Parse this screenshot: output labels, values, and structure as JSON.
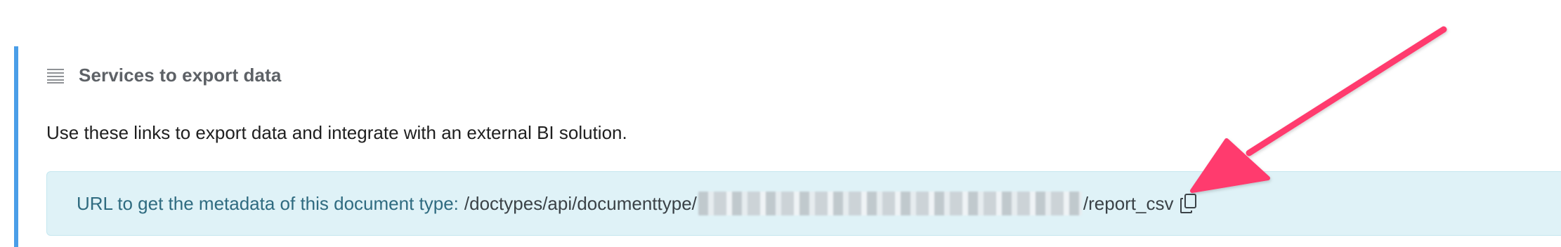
{
  "section": {
    "title": "Services to export data",
    "description": "Use these links to export data and integrate with an external BI solution."
  },
  "info_box": {
    "label": "URL to get the metadata of this document type:",
    "path_prefix": "/doctypes/api/documenttype/",
    "path_suffix": "/report_csv"
  },
  "colors": {
    "accent_border": "#4a9ee8",
    "info_background": "#dff2f7",
    "arrow": "#ff3b6e"
  },
  "icons": {
    "section_icon": "hamburger-icon",
    "copy": "copy-icon"
  }
}
